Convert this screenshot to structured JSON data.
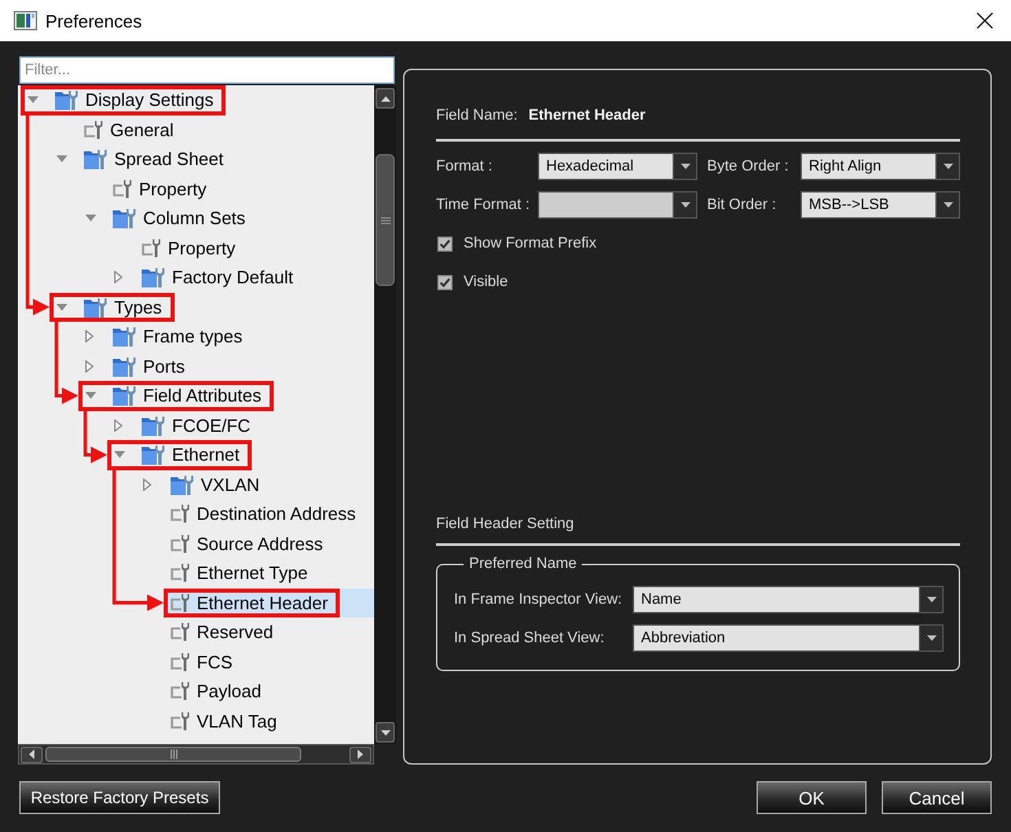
{
  "window": {
    "title": "Preferences"
  },
  "filter": {
    "placeholder": "Filter..."
  },
  "tree": [
    {
      "label": "Display Settings",
      "kind": "folder",
      "expanded": true,
      "selected": false,
      "highlighted": true,
      "children": [
        {
          "label": "General",
          "kind": "item",
          "selected": false,
          "highlighted": false
        },
        {
          "label": "Spread Sheet",
          "kind": "folder",
          "expanded": true,
          "selected": false,
          "highlighted": false,
          "children": [
            {
              "label": "Property",
              "kind": "item",
              "selected": false,
              "highlighted": false
            },
            {
              "label": "Column Sets",
              "kind": "folder",
              "expanded": true,
              "selected": false,
              "highlighted": false,
              "children": [
                {
                  "label": "Property",
                  "kind": "item",
                  "selected": false,
                  "highlighted": false
                },
                {
                  "label": "Factory Default",
                  "kind": "folder",
                  "expanded": false,
                  "selected": false,
                  "highlighted": false
                }
              ]
            }
          ]
        },
        {
          "label": "Types",
          "kind": "folder",
          "expanded": true,
          "selected": false,
          "highlighted": true,
          "children": [
            {
              "label": "Frame types",
              "kind": "folder",
              "expanded": false,
              "selected": false,
              "highlighted": false
            },
            {
              "label": "Ports",
              "kind": "folder",
              "expanded": false,
              "selected": false,
              "highlighted": false
            },
            {
              "label": "Field Attributes",
              "kind": "folder",
              "expanded": true,
              "selected": false,
              "highlighted": true,
              "children": [
                {
                  "label": "FCOE/FC",
                  "kind": "folder",
                  "expanded": false,
                  "selected": false,
                  "highlighted": false
                },
                {
                  "label": "Ethernet",
                  "kind": "folder",
                  "expanded": true,
                  "selected": false,
                  "highlighted": true,
                  "children": [
                    {
                      "label": "VXLAN",
                      "kind": "folder",
                      "expanded": false,
                      "selected": false,
                      "highlighted": false
                    },
                    {
                      "label": "Destination Address",
                      "kind": "item",
                      "selected": false,
                      "highlighted": false
                    },
                    {
                      "label": "Source Address",
                      "kind": "item",
                      "selected": false,
                      "highlighted": false
                    },
                    {
                      "label": "Ethernet Type",
                      "kind": "item",
                      "selected": false,
                      "highlighted": false
                    },
                    {
                      "label": "Ethernet Header",
                      "kind": "item",
                      "selected": true,
                      "highlighted": true
                    },
                    {
                      "label": "Reserved",
                      "kind": "item",
                      "selected": false,
                      "highlighted": false
                    },
                    {
                      "label": "FCS",
                      "kind": "item",
                      "selected": false,
                      "highlighted": false
                    },
                    {
                      "label": "Payload",
                      "kind": "item",
                      "selected": false,
                      "highlighted": false
                    },
                    {
                      "label": "VLAN Tag",
                      "kind": "item",
                      "selected": false,
                      "highlighted": false
                    }
                  ]
                }
              ]
            }
          ]
        }
      ]
    }
  ],
  "details": {
    "field_name_label": "Field Name:",
    "field_name": "Ethernet Header",
    "dropdowns": [
      {
        "label": "Format :",
        "value": "Hexadecimal",
        "disabled": false
      },
      {
        "label": "Byte Order :",
        "value": "Right Align",
        "disabled": false
      },
      {
        "label": "Time Format :",
        "disabled": true
      },
      {
        "label": "Bit Order :",
        "value": "MSB-->LSB",
        "disabled": false
      }
    ],
    "checkboxes": [
      {
        "label": "Show Format Prefix",
        "checked": true
      },
      {
        "label": "Visible",
        "checked": true
      }
    ],
    "header_section": {
      "title": "Field Header Setting",
      "group": {
        "legend": "Preferred Name",
        "fields": [
          {
            "label": "In Frame Inspector View:",
            "value": "Name"
          },
          {
            "label": "In Spread Sheet View:",
            "value": "Abbreviation"
          }
        ]
      }
    }
  },
  "footer": {
    "restore_button": "Restore Factory Presets",
    "ok_button": "OK",
    "cancel_button": "Cancel"
  }
}
